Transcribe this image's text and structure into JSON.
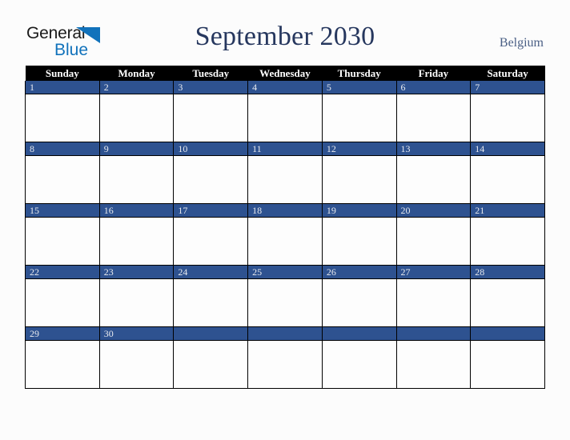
{
  "brand": {
    "name_part1": "General",
    "name_part2": "Blue",
    "triangle_color": "#1172bb",
    "text_color": "#1a1a1a"
  },
  "header": {
    "title": "September 2030",
    "region": "Belgium",
    "title_color": "#26375e",
    "region_color": "#4a5f85"
  },
  "calendar": {
    "month": "September",
    "year": "2030",
    "weekday_headers": [
      "Sunday",
      "Monday",
      "Tuesday",
      "Wednesday",
      "Thursday",
      "Friday",
      "Saturday"
    ],
    "header_bg": "#000000",
    "header_text": "#ffffff",
    "daynum_bg": "#2e5290",
    "daynum_text": "#e8eaef",
    "cell_bg": "#fdfdfd",
    "border_color": "#000000",
    "weeks": [
      [
        "1",
        "2",
        "3",
        "4",
        "5",
        "6",
        "7"
      ],
      [
        "8",
        "9",
        "10",
        "11",
        "12",
        "13",
        "14"
      ],
      [
        "15",
        "16",
        "17",
        "18",
        "19",
        "20",
        "21"
      ],
      [
        "22",
        "23",
        "24",
        "25",
        "26",
        "27",
        "28"
      ],
      [
        "29",
        "30",
        "",
        "",
        "",
        "",
        ""
      ]
    ]
  },
  "page": {
    "background": "#fcfcfc"
  }
}
